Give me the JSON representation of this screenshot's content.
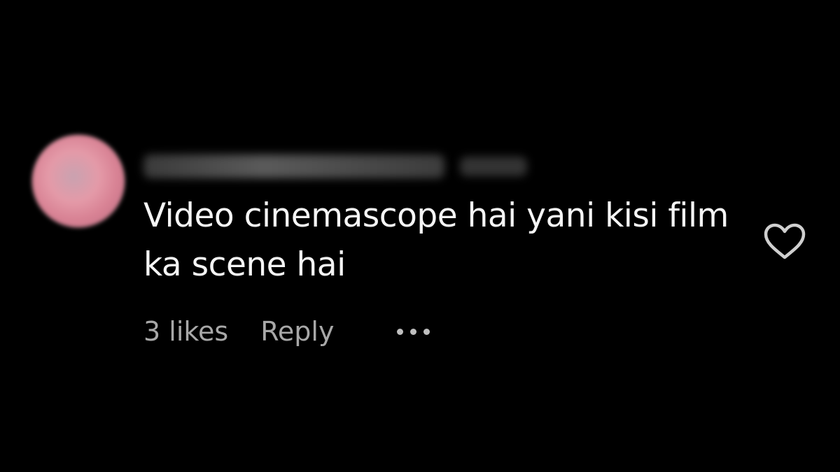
{
  "comment": {
    "text": "Video cinemascope hai yani kisi film ka scene hai",
    "likes_label": "3 likes",
    "reply_label": "Reply",
    "more_icon": "more-options-icon",
    "like_icon": "heart-icon"
  },
  "colors": {
    "background": "#000000",
    "text_primary": "#f5f5f5",
    "text_secondary": "#a8a8a8"
  }
}
